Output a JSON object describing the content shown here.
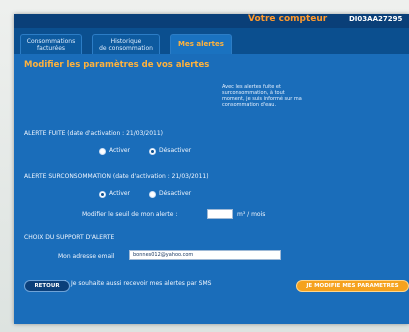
{
  "header": {
    "title": "Votre compteur",
    "meter_id": "DI03AA27295"
  },
  "tabs": [
    {
      "label_line1": "Consommations",
      "label_line2": "facturées"
    },
    {
      "label_line1": "Historique",
      "label_line2": "de consommation"
    },
    {
      "label": "Mes alertes"
    }
  ],
  "page": {
    "heading": "Modifier les paramètres de vos alertes",
    "info_text": "Avec les alertes fuite et surconsommation, à tout moment, je suis informé sur ma consommation d'eau."
  },
  "leak_alert": {
    "label": "ALERTE FUITE (date d'activation : 21/03/2011)",
    "option_on": "Activer",
    "option_off": "Désactiver",
    "selected": "Désactiver"
  },
  "overuse_alert": {
    "label": "ALERTE SURCONSOMMATION (date d'activation : 21/03/2011)",
    "option_on": "Activer",
    "option_off": "Désactiver",
    "selected": "Activer",
    "threshold_label": "Modifier le seuil de mon alerte :",
    "threshold_value": "",
    "threshold_unit": "m³ / mois"
  },
  "support": {
    "label": "CHOIX DU SUPPORT D'ALERTE",
    "email_label": "Mon adresse email",
    "email_value": "bonnes012@yahoo.com",
    "sms_label": "Je souhaite aussi recevoir mes alertes par SMS",
    "sms_checked": false
  },
  "buttons": {
    "back": "RETOUR",
    "save": "JE MODIFIE MES PARAMETRES"
  },
  "colors": {
    "accent": "#ffb23c",
    "panel": "#1a6dba",
    "header": "#0a3f78",
    "save_button": "#f5a21e"
  }
}
